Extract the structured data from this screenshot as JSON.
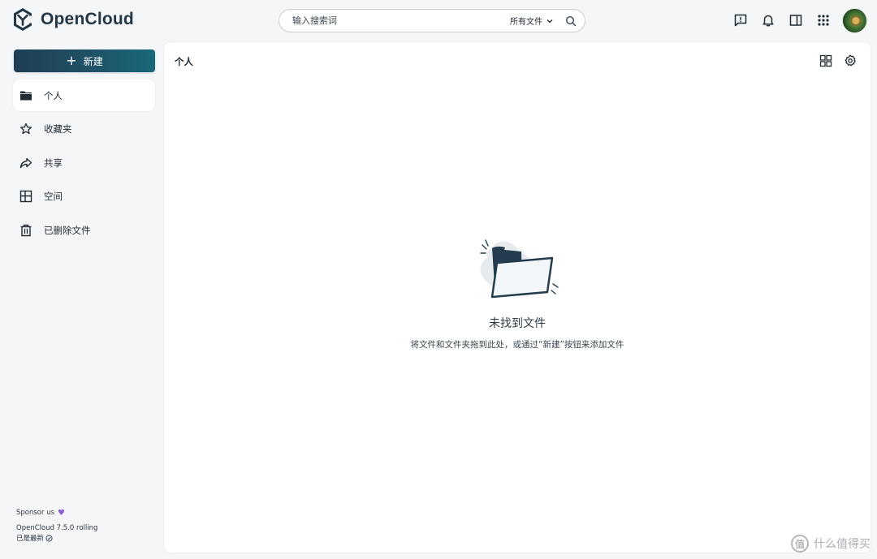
{
  "app": {
    "brand": "OpenCloud"
  },
  "search": {
    "placeholder": "输入搜索词",
    "scope": "所有文件"
  },
  "new_button": {
    "label": "新建"
  },
  "sidebar": {
    "items": [
      {
        "label": "个人",
        "icon": "folder-icon",
        "active": true
      },
      {
        "label": "收藏夹",
        "icon": "star-icon"
      },
      {
        "label": "共享",
        "icon": "share-icon"
      },
      {
        "label": "空间",
        "icon": "spaces-icon"
      },
      {
        "label": "已删除文件",
        "icon": "trash-icon"
      }
    ],
    "footer": {
      "sponsor": "Sponsor us",
      "version": "OpenCloud 7.5.0 rolling",
      "status": "已是最新"
    }
  },
  "main": {
    "title": "个人",
    "empty_title": "未找到文件",
    "empty_subtitle": "将文件和文件夹拖到此处，或通过“新建”按钮来添加文件"
  },
  "watermark": {
    "text": "什么值得买",
    "glyph": "值"
  },
  "colors": {
    "accent": "#1f5266",
    "text": "#1f2a33",
    "sponsor_heart": "#8b5bd6"
  }
}
